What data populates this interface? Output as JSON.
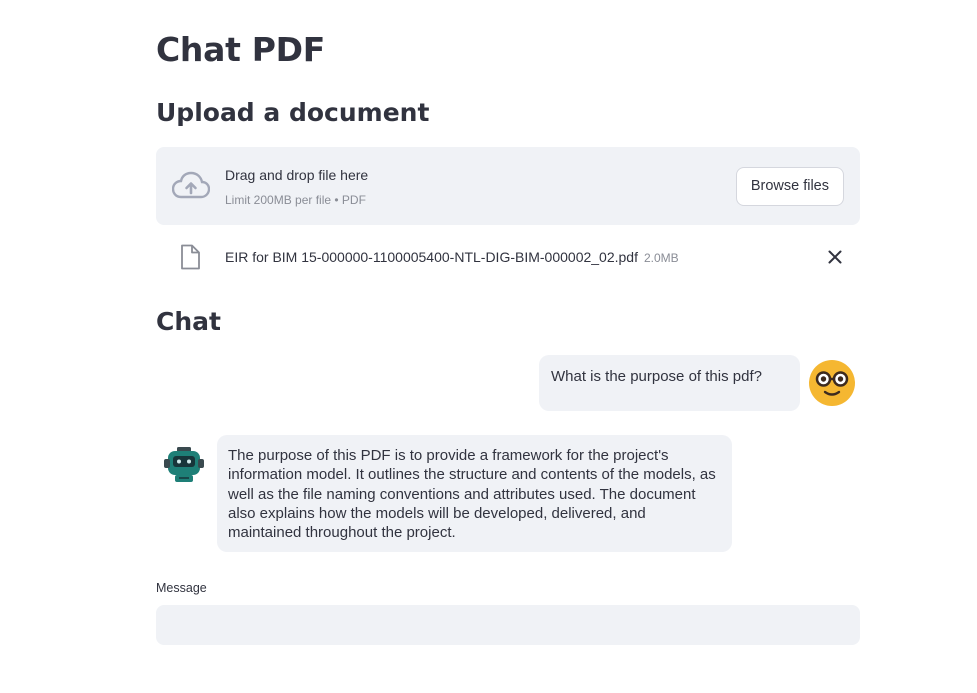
{
  "app": {
    "title": "Chat PDF"
  },
  "upload": {
    "heading": "Upload a document",
    "dropzone_text": "Drag and drop file here",
    "limit_text": "Limit 200MB per file • PDF",
    "browse_label": "Browse files",
    "file": {
      "name": "EIR for BIM 15-000000-1100005400-NTL-DIG-BIM-000002_02.pdf",
      "size": "2.0MB"
    }
  },
  "chat": {
    "heading": "Chat",
    "messages": [
      {
        "role": "user",
        "text": "What is the purpose of this pdf?"
      },
      {
        "role": "assistant",
        "text": "The purpose of this PDF is to provide a framework for the project's information model. It outlines the structure and contents of the models, as well as the file naming conventions and attributes used. The document also explains how the models will be developed, delivered, and maintained throughout the project."
      }
    ]
  },
  "input": {
    "label": "Message",
    "value": ""
  },
  "colors": {
    "panel": "#f0f2f6",
    "text": "#31333f",
    "muted": "#8a8d96",
    "user_avatar": "#f5b731",
    "bot_avatar": "#1e7f77"
  }
}
